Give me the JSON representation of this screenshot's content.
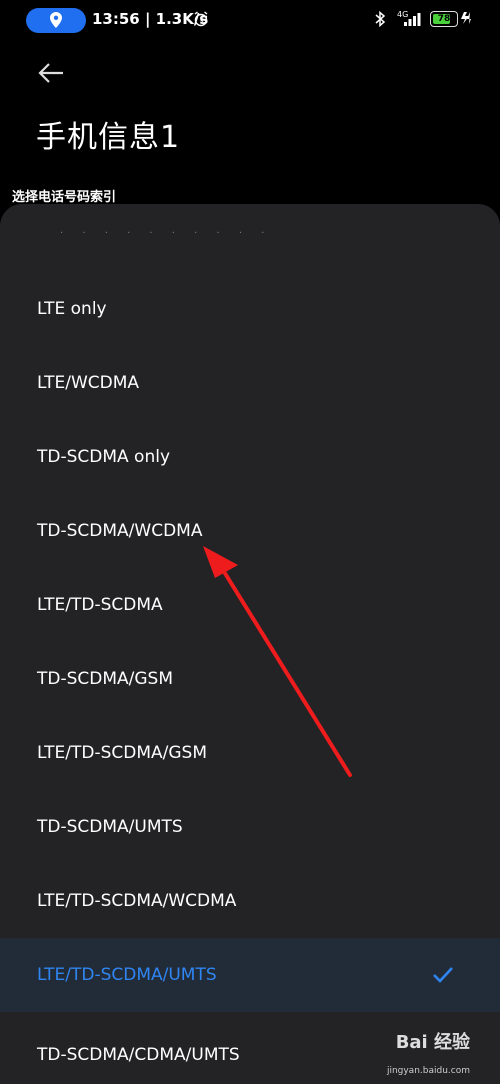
{
  "status_bar": {
    "time_speed": "13:56 | 1.3K/s",
    "network": "4G",
    "battery": "78",
    "battery_level": 0.78
  },
  "header": {
    "title": "手机信息1",
    "section_label": "选择电话号码索引"
  },
  "sheet": {
    "options": [
      "LTE only",
      "LTE/WCDMA",
      "TD-SCDMA only",
      "TD-SCDMA/WCDMA",
      "LTE/TD-SCDMA",
      "TD-SCDMA/GSM",
      "LTE/TD-SCDMA/GSM",
      "TD-SCDMA/UMTS",
      "LTE/TD-SCDMA/WCDMA",
      "LTE/TD-SCDMA/UMTS",
      "TD-SCDMA/CDMA/UMTS"
    ],
    "selected_index": 9
  },
  "colors": {
    "accent": "#2f86f2",
    "annotation_arrow": "#ee1c1c"
  },
  "watermark": {
    "brand": "Bai 经验",
    "url": "jingyan.baidu.com"
  }
}
